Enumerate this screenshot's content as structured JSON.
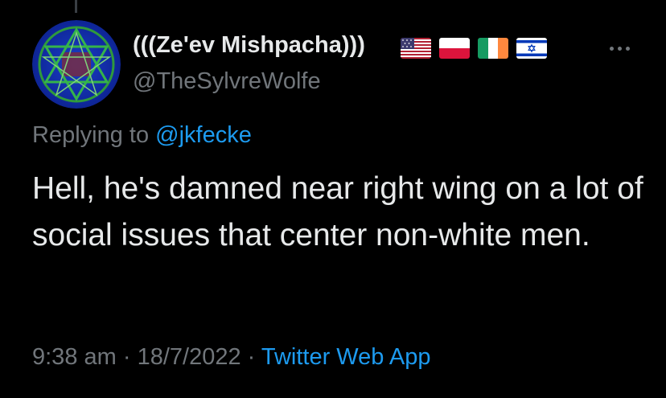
{
  "tweet": {
    "author": {
      "display_name": "(((Ze'ev Mishpacha)))",
      "handle": "@TheSylvreWolfe",
      "flags": [
        "us-flag-icon",
        "poland-flag-icon",
        "ireland-flag-icon",
        "israel-flag-icon"
      ]
    },
    "replying_label": "Replying to ",
    "replying_to": "@jkfecke",
    "text": "Hell, he's damned near right wing on a lot of social issues that center non-white men.",
    "time": "9:38 am",
    "separator": " · ",
    "date": "18/7/2022",
    "source": "Twitter Web App"
  },
  "icons": {
    "avatar": "pentagram-hexagram-avatar",
    "more": "more-options-icon"
  },
  "colors": {
    "background": "#000000",
    "text": "#e7e9ea",
    "secondary": "#71767b",
    "link": "#1d9bf0"
  }
}
